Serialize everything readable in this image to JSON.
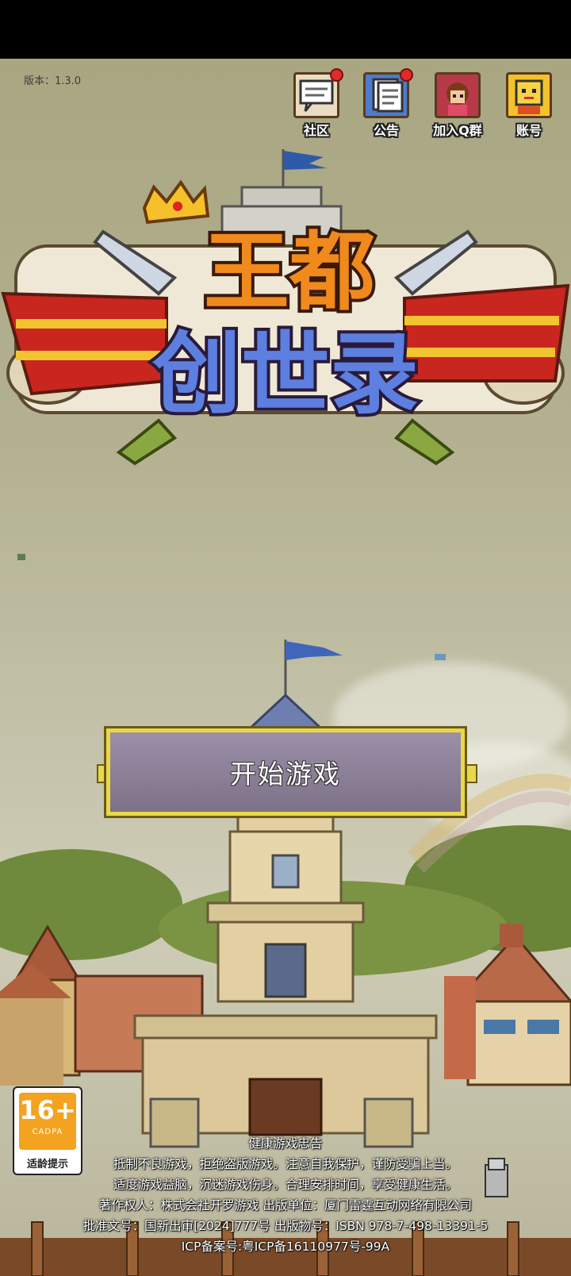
{
  "version": "版本：1.3.0",
  "top_icons": [
    {
      "label": "社区",
      "icon": "community-speech-bubble-icon",
      "badge": true
    },
    {
      "label": "公告",
      "icon": "announcement-document-icon",
      "badge": true
    },
    {
      "label": "加入Q群",
      "icon": "join-qq-group-avatar-icon",
      "badge": false
    },
    {
      "label": "账号",
      "icon": "account-face-icon",
      "badge": false
    }
  ],
  "logo": {
    "line1": "王都",
    "line2": "创世录"
  },
  "start_button": "开始游戏",
  "age_rating": {
    "age": "16+",
    "org": "CADPA",
    "tip": "适龄提示"
  },
  "legal": {
    "heading": "健康游戏忠告",
    "line1": "抵制不良游戏，拒绝盗版游戏。注意自我保护，谨防受骗上当。",
    "line2": "适度游戏益脑，沉迷游戏伤身。合理安排时间，享受健康生活。",
    "line3": "著作权人：株式会社开罗游戏  出版单位：厦门雷霆互动网络有限公司",
    "line4": "批准文号：国新出审[2024]777号 出版物号：ISBN 978-7-498-13391-5",
    "line5": "ICP备案号:粤ICP备16110977号-99A"
  },
  "colors": {
    "accent": "#e8d84a",
    "badge": "#e02b2b",
    "age_orange": "#f3a31f"
  }
}
